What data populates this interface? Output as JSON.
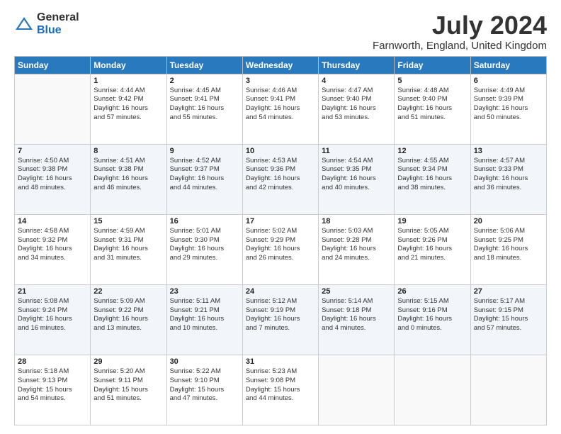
{
  "logo": {
    "general": "General",
    "blue": "Blue"
  },
  "header": {
    "title": "July 2024",
    "subtitle": "Farnworth, England, United Kingdom"
  },
  "weekdays": [
    "Sunday",
    "Monday",
    "Tuesday",
    "Wednesday",
    "Thursday",
    "Friday",
    "Saturday"
  ],
  "weeks": [
    [
      {
        "day": "",
        "info": ""
      },
      {
        "day": "1",
        "info": "Sunrise: 4:44 AM\nSunset: 9:42 PM\nDaylight: 16 hours\nand 57 minutes."
      },
      {
        "day": "2",
        "info": "Sunrise: 4:45 AM\nSunset: 9:41 PM\nDaylight: 16 hours\nand 55 minutes."
      },
      {
        "day": "3",
        "info": "Sunrise: 4:46 AM\nSunset: 9:41 PM\nDaylight: 16 hours\nand 54 minutes."
      },
      {
        "day": "4",
        "info": "Sunrise: 4:47 AM\nSunset: 9:40 PM\nDaylight: 16 hours\nand 53 minutes."
      },
      {
        "day": "5",
        "info": "Sunrise: 4:48 AM\nSunset: 9:40 PM\nDaylight: 16 hours\nand 51 minutes."
      },
      {
        "day": "6",
        "info": "Sunrise: 4:49 AM\nSunset: 9:39 PM\nDaylight: 16 hours\nand 50 minutes."
      }
    ],
    [
      {
        "day": "7",
        "info": "Sunrise: 4:50 AM\nSunset: 9:38 PM\nDaylight: 16 hours\nand 48 minutes."
      },
      {
        "day": "8",
        "info": "Sunrise: 4:51 AM\nSunset: 9:38 PM\nDaylight: 16 hours\nand 46 minutes."
      },
      {
        "day": "9",
        "info": "Sunrise: 4:52 AM\nSunset: 9:37 PM\nDaylight: 16 hours\nand 44 minutes."
      },
      {
        "day": "10",
        "info": "Sunrise: 4:53 AM\nSunset: 9:36 PM\nDaylight: 16 hours\nand 42 minutes."
      },
      {
        "day": "11",
        "info": "Sunrise: 4:54 AM\nSunset: 9:35 PM\nDaylight: 16 hours\nand 40 minutes."
      },
      {
        "day": "12",
        "info": "Sunrise: 4:55 AM\nSunset: 9:34 PM\nDaylight: 16 hours\nand 38 minutes."
      },
      {
        "day": "13",
        "info": "Sunrise: 4:57 AM\nSunset: 9:33 PM\nDaylight: 16 hours\nand 36 minutes."
      }
    ],
    [
      {
        "day": "14",
        "info": "Sunrise: 4:58 AM\nSunset: 9:32 PM\nDaylight: 16 hours\nand 34 minutes."
      },
      {
        "day": "15",
        "info": "Sunrise: 4:59 AM\nSunset: 9:31 PM\nDaylight: 16 hours\nand 31 minutes."
      },
      {
        "day": "16",
        "info": "Sunrise: 5:01 AM\nSunset: 9:30 PM\nDaylight: 16 hours\nand 29 minutes."
      },
      {
        "day": "17",
        "info": "Sunrise: 5:02 AM\nSunset: 9:29 PM\nDaylight: 16 hours\nand 26 minutes."
      },
      {
        "day": "18",
        "info": "Sunrise: 5:03 AM\nSunset: 9:28 PM\nDaylight: 16 hours\nand 24 minutes."
      },
      {
        "day": "19",
        "info": "Sunrise: 5:05 AM\nSunset: 9:26 PM\nDaylight: 16 hours\nand 21 minutes."
      },
      {
        "day": "20",
        "info": "Sunrise: 5:06 AM\nSunset: 9:25 PM\nDaylight: 16 hours\nand 18 minutes."
      }
    ],
    [
      {
        "day": "21",
        "info": "Sunrise: 5:08 AM\nSunset: 9:24 PM\nDaylight: 16 hours\nand 16 minutes."
      },
      {
        "day": "22",
        "info": "Sunrise: 5:09 AM\nSunset: 9:22 PM\nDaylight: 16 hours\nand 13 minutes."
      },
      {
        "day": "23",
        "info": "Sunrise: 5:11 AM\nSunset: 9:21 PM\nDaylight: 16 hours\nand 10 minutes."
      },
      {
        "day": "24",
        "info": "Sunrise: 5:12 AM\nSunset: 9:19 PM\nDaylight: 16 hours\nand 7 minutes."
      },
      {
        "day": "25",
        "info": "Sunrise: 5:14 AM\nSunset: 9:18 PM\nDaylight: 16 hours\nand 4 minutes."
      },
      {
        "day": "26",
        "info": "Sunrise: 5:15 AM\nSunset: 9:16 PM\nDaylight: 16 hours\nand 0 minutes."
      },
      {
        "day": "27",
        "info": "Sunrise: 5:17 AM\nSunset: 9:15 PM\nDaylight: 15 hours\nand 57 minutes."
      }
    ],
    [
      {
        "day": "28",
        "info": "Sunrise: 5:18 AM\nSunset: 9:13 PM\nDaylight: 15 hours\nand 54 minutes."
      },
      {
        "day": "29",
        "info": "Sunrise: 5:20 AM\nSunset: 9:11 PM\nDaylight: 15 hours\nand 51 minutes."
      },
      {
        "day": "30",
        "info": "Sunrise: 5:22 AM\nSunset: 9:10 PM\nDaylight: 15 hours\nand 47 minutes."
      },
      {
        "day": "31",
        "info": "Sunrise: 5:23 AM\nSunset: 9:08 PM\nDaylight: 15 hours\nand 44 minutes."
      },
      {
        "day": "",
        "info": ""
      },
      {
        "day": "",
        "info": ""
      },
      {
        "day": "",
        "info": ""
      }
    ]
  ]
}
